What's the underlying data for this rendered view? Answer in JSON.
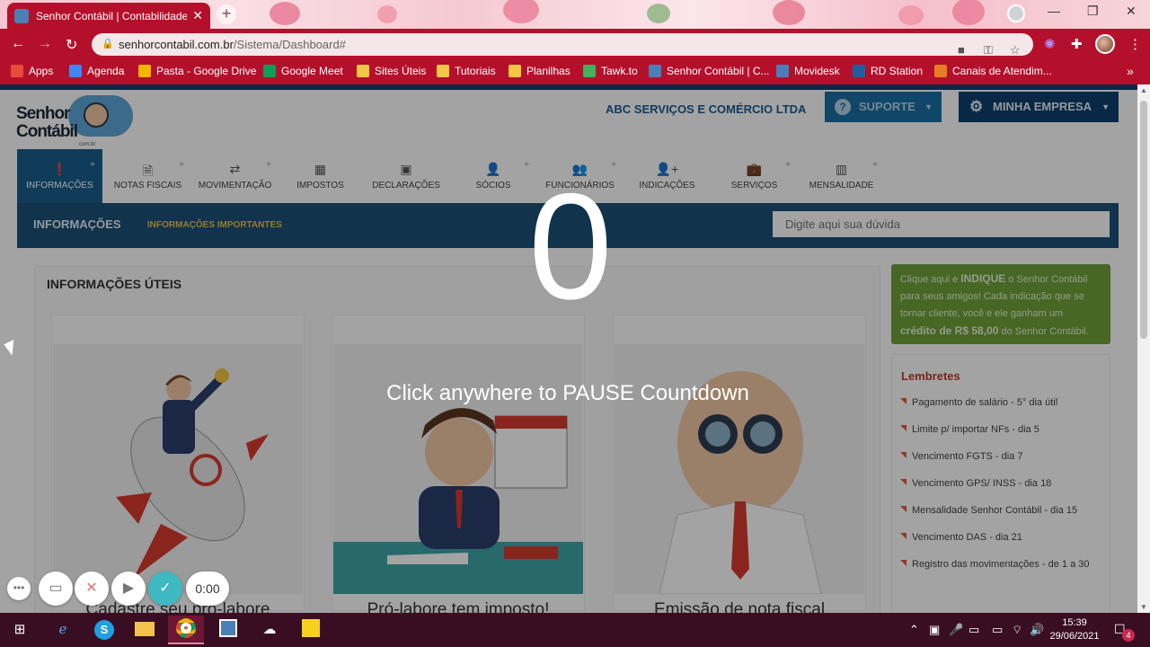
{
  "browser": {
    "tab_title": "Senhor Contábil | Contabilidade O",
    "tab_close": "✕",
    "new_tab": "+",
    "url_host": "senhorcontabil.com.br",
    "url_path": "/Sistema/Dashboard#",
    "win_min": "—",
    "win_restore": "❐",
    "win_close": "✕",
    "back": "←",
    "forward": "→",
    "reload": "↻"
  },
  "bookmarks": [
    {
      "label": "Apps",
      "color": "#e74c3c"
    },
    {
      "label": "Agenda",
      "color": "#4285f4"
    },
    {
      "label": "Pasta - Google Drive",
      "color": "#f4b400"
    },
    {
      "label": "Google Meet",
      "color": "#0f9d58"
    },
    {
      "label": "Sites Úteis",
      "color": "#f6c744"
    },
    {
      "label": "Tutoriais",
      "color": "#f6c744"
    },
    {
      "label": "Planilhas",
      "color": "#f6c744"
    },
    {
      "label": "Tawk.to",
      "color": "#43b05c"
    },
    {
      "label": "Senhor Contábil | C...",
      "color": "#4a7fb8"
    },
    {
      "label": "Movidesk",
      "color": "#4a7fb8"
    },
    {
      "label": "RD Station",
      "color": "#1f5f9e"
    },
    {
      "label": "Canais de Atendim...",
      "color": "#e67e22"
    }
  ],
  "bookmarks_more": "»",
  "header": {
    "logo_line1": "Senhor",
    "logo_line2": "Contábil",
    "logo_line3": "com.br",
    "company": "ABC SERVIÇOS E COMÉRCIO LTDA",
    "suporte": "SUPORTE",
    "minha_empresa": "MINHA EMPRESA"
  },
  "menu": [
    {
      "label": "INFORMAÇÕES",
      "icon": "❗",
      "active": true
    },
    {
      "label": "NOTAS FISCAIS",
      "icon": "🗎"
    },
    {
      "label": "MOVIMENTAÇÃO",
      "icon": "⇄"
    },
    {
      "label": "IMPOSTOS",
      "icon": "▦"
    },
    {
      "label": "DECLARAÇÕES",
      "icon": "▣"
    },
    {
      "label": "SÓCIOS",
      "icon": "👤"
    },
    {
      "label": "FUNCIONÁRIOS",
      "icon": "👥"
    },
    {
      "label": "INDICAÇÕES",
      "icon": "👤+"
    },
    {
      "label": "SERVIÇOS",
      "icon": "💼"
    },
    {
      "label": "MENSALIDADE",
      "icon": "▥"
    }
  ],
  "subbar": {
    "title": "INFORMAÇÕES",
    "link": "INFORMAÇÕES IMPORTANTES",
    "search_placeholder": "Digite aqui sua dúvida"
  },
  "info": {
    "title": "INFORMAÇÕES ÚTEIS",
    "cards": [
      {
        "caption": "Cadastre seu pró-labore"
      },
      {
        "caption": "Pró-labore tem imposto!"
      },
      {
        "caption": "Emissão de nota fiscal"
      }
    ]
  },
  "promo": {
    "t1": "Clique aqui e ",
    "t2": "INDIQUE",
    "t3": " o Senhor Contábil para seus amigos! Cada indicação que se tornar cliente, você e ele ganham um ",
    "t4": "crédito de R$ 58,00",
    "t5": " do Senhor Contábil."
  },
  "reminders": {
    "title": "Lembretes",
    "items": [
      "Pagamento de salário - 5° dia útil",
      "Limite p/ importar NFs - dia 5",
      "Vencimento FGTS - dia 7",
      "Vencimento GPS/ INSS - dia 18",
      "Mensalidade Senhor Contábil - dia 15",
      "Vencimento DAS - dia 21",
      "Registro das movimentações - de 1 a 30"
    ]
  },
  "overlay": {
    "countdown": "0",
    "hint": "Click anywhere to PAUSE Countdown",
    "timer": "0:00"
  },
  "taskbar": {
    "time": "15:39",
    "date": "29/06/2021",
    "notifications": "4"
  },
  "colors": {
    "browser_accent": "#b5102b",
    "brand_blue": "#1b5177",
    "promo_green": "#6fa23a",
    "reminder_red": "#c0392b",
    "taskbar": "#3a0e22"
  }
}
